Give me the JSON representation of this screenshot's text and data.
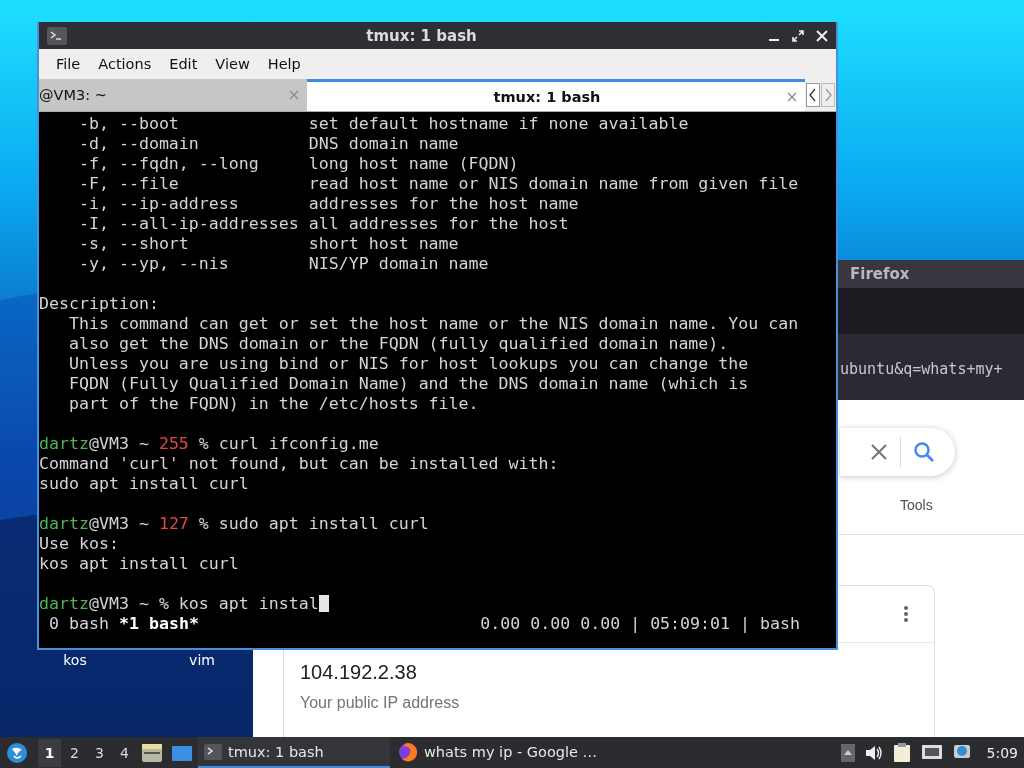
{
  "desktop": {
    "icons": [
      {
        "label": "kos"
      },
      {
        "label": "vim"
      }
    ]
  },
  "firefox": {
    "title": "Firefox",
    "url": "ubuntu&q=whats+my+",
    "tools": "Tools",
    "result": {
      "ip": "104.192.2.38",
      "caption": "Your public IP address"
    }
  },
  "terminal": {
    "title": "tmux: 1 bash",
    "menu": [
      "File",
      "Actions",
      "Edit",
      "View",
      "Help"
    ],
    "tabs": [
      {
        "label": "@VM3: ~",
        "selected": false
      },
      {
        "label": "tmux: 1 bash",
        "selected": true
      }
    ],
    "blocks": [
      {
        "lines": [
          [
            {
              "text": "    -b, --boot             set default hostname if none available",
              "kind": "text"
            }
          ],
          [
            {
              "text": "    -d, --domain           DNS domain name",
              "kind": "text"
            }
          ],
          [
            {
              "text": "    -f, --fqdn, --long     long host name (FQDN)",
              "kind": "text"
            }
          ],
          [
            {
              "text": "    -F, --file             read host name or NIS domain name from given file",
              "kind": "text"
            }
          ],
          [
            {
              "text": "    -i, --ip-address       addresses for the host name",
              "kind": "text"
            }
          ],
          [
            {
              "text": "    -I, --all-ip-addresses all addresses for the host",
              "kind": "text"
            }
          ],
          [
            {
              "text": "    -s, --short            short host name",
              "kind": "text"
            }
          ],
          [
            {
              "text": "    -y, --yp, --nis        NIS/YP domain name",
              "kind": "text"
            }
          ]
        ]
      },
      {
        "lines": [
          [
            {
              "text": "Description:",
              "kind": "text"
            }
          ],
          [
            {
              "text": "   This command can get or set the host name or the NIS domain name. You can",
              "kind": "text"
            }
          ],
          [
            {
              "text": "   also get the DNS domain or the FQDN (fully qualified domain name).",
              "kind": "text"
            }
          ],
          [
            {
              "text": "   Unless you are using bind or NIS for host lookups you can change the",
              "kind": "text"
            }
          ],
          [
            {
              "text": "   FQDN (Fully Qualified Domain Name) and the DNS domain name (which is",
              "kind": "text"
            }
          ],
          [
            {
              "text": "   part of the FQDN) in the /etc/hosts file.",
              "kind": "text"
            }
          ]
        ]
      },
      {
        "lines": [
          [
            {
              "text": "dartz",
              "kind": "user"
            },
            {
              "text": "@VM3 ~ ",
              "kind": "text"
            },
            {
              "text": "255",
              "kind": "error"
            },
            {
              "text": " % curl ifconfig.me",
              "kind": "text"
            }
          ],
          [
            {
              "text": "Command 'curl' not found, but can be installed with:",
              "kind": "text"
            }
          ],
          [
            {
              "text": "sudo apt install curl",
              "kind": "text"
            }
          ]
        ]
      },
      {
        "lines": [
          [
            {
              "text": "dartz",
              "kind": "user"
            },
            {
              "text": "@VM3 ~ ",
              "kind": "text"
            },
            {
              "text": "127",
              "kind": "error"
            },
            {
              "text": " % sudo apt install curl",
              "kind": "text"
            }
          ],
          [
            {
              "text": "Use kos:",
              "kind": "text"
            }
          ],
          [
            {
              "text": "kos apt install curl",
              "kind": "text"
            }
          ]
        ]
      },
      {
        "lines": [
          [
            {
              "text": "dartz",
              "kind": "user"
            },
            {
              "text": "@VM3 ~ % kos apt instal",
              "kind": "text"
            }
          ]
        ]
      }
    ],
    "cursor": true,
    "status": {
      "windows": [
        {
          "label": "0 bash",
          "selected": false
        },
        {
          "label": "*1 bash*",
          "selected": true
        }
      ],
      "right": "0.00 0.00 0.00 | 05:09:01 | bash"
    }
  },
  "taskbar": {
    "workspaces": [
      {
        "label": "1",
        "selected": true
      },
      {
        "label": "2",
        "selected": false
      },
      {
        "label": "3",
        "selected": false
      },
      {
        "label": "4",
        "selected": false
      }
    ],
    "tasks": [
      {
        "label": "tmux: 1 bash",
        "kind": "terminal",
        "selected": true
      },
      {
        "label": "whats my ip - Google …",
        "kind": "browser",
        "selected": false
      }
    ],
    "clock": "5:09"
  }
}
